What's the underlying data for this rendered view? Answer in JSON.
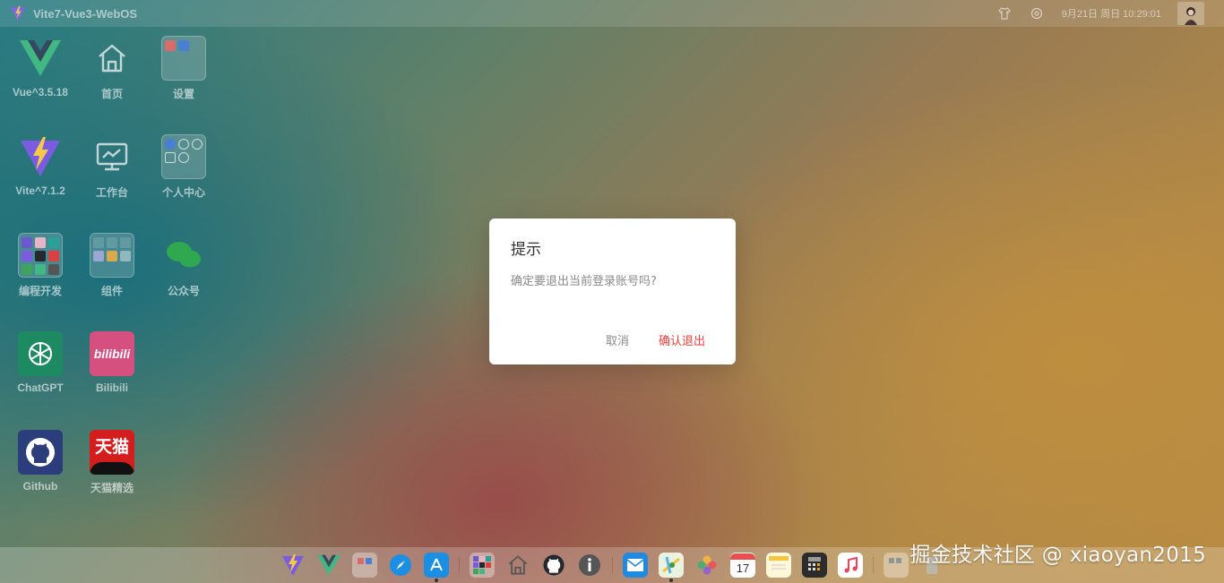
{
  "app": {
    "title": "Vite7-Vue3-WebOS"
  },
  "topbar": {
    "clock": "9月21日 周日 10:29:01"
  },
  "desktop": {
    "apps": [
      {
        "label": "Vue^3.5.18"
      },
      {
        "label": "首页"
      },
      {
        "label": "设置"
      },
      {
        "label": "Vite^7.1.2"
      },
      {
        "label": "工作台"
      },
      {
        "label": "个人中心"
      },
      {
        "label": "编程开发"
      },
      {
        "label": "组件"
      },
      {
        "label": "公众号"
      },
      {
        "label": "ChatGPT"
      },
      {
        "label": "Bilibili"
      },
      {
        "label": "Github"
      },
      {
        "label": "天猫精选"
      }
    ]
  },
  "icon_text": {
    "bilibili": "bilibili",
    "tmall": "天猫",
    "calendar_day": "17"
  },
  "dialog": {
    "title": "提示",
    "message": "确定要退出当前登录账号吗?",
    "cancel_label": "取消",
    "confirm_label": "确认退出"
  },
  "colors": {
    "confirm": "#f23c3c",
    "chatgpt": "#10a37f",
    "bilibili": "#e8598a",
    "github": "#24292f",
    "tmall": "#e2231a"
  },
  "watermark": "掘金技术社区 @ xiaoyan2015"
}
